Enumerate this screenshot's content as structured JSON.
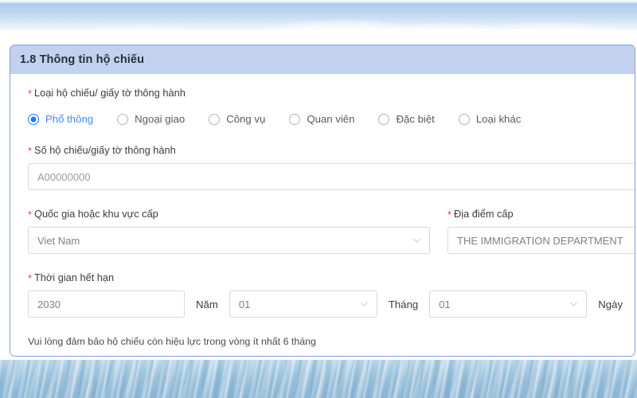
{
  "card": {
    "header_title": "1.8 Thông tin hộ chiếu"
  },
  "passport_type": {
    "label": "Loại hộ chiếu/ giấy tờ thông hành",
    "required_mark": "*",
    "options": [
      {
        "label": "Phổ thông",
        "selected": true
      },
      {
        "label": "Ngoại giao",
        "selected": false
      },
      {
        "label": "Công vụ",
        "selected": false
      },
      {
        "label": "Quan viên",
        "selected": false
      },
      {
        "label": "Đặc biệt",
        "selected": false
      },
      {
        "label": "Loại khác",
        "selected": false
      }
    ]
  },
  "passport_number": {
    "label": "Số hộ chiếu/giấy tờ thông hành",
    "required_mark": "*",
    "placeholder": "A00000000",
    "value": ""
  },
  "issuing_country": {
    "label": "Quốc gia hoặc khu vực cấp",
    "required_mark": "*",
    "value": "Viet Nam",
    "icon": "chevron-down-icon"
  },
  "issuing_place": {
    "label": "Địa điểm cấp",
    "required_mark": "*",
    "value": "THE IMMIGRATION DEPARTMENT"
  },
  "expiry": {
    "label": "Thời gian hết hạn",
    "required_mark": "*",
    "year_value": "2030",
    "year_unit": "Năm",
    "month_value": "01",
    "month_unit": "Tháng",
    "day_value": "01",
    "day_unit": "Ngày",
    "icon": "chevron-down-icon"
  },
  "note": {
    "text": "Vui lòng đảm bảo hộ chiếu còn hiệu lực trong vòng ít nhất 6 tháng"
  },
  "colors": {
    "header_band": "#c2d2ee",
    "card_border": "#7f9fd8",
    "accent_blue": "#1a7cf0",
    "required_red": "#e0443c",
    "input_border": "#d9d9d9"
  }
}
